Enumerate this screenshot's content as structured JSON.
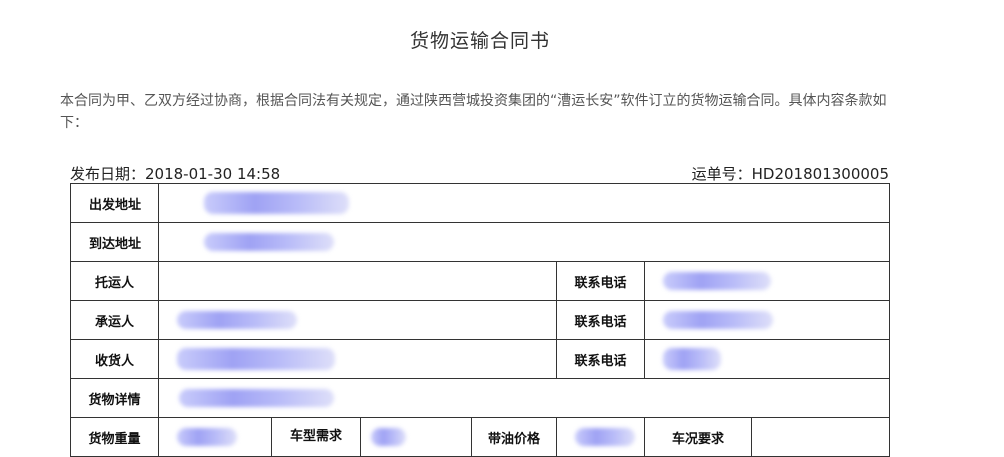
{
  "document": {
    "title": "货物运输合同书",
    "intro": "本合同为甲、乙双方经过协商，根据合同法有关规定，通过陕西营城投资集团的“漕运长安”软件订立的货物运输合同。具体内容条款如下：",
    "publish_date": "发布日期：2018-01-30 14:58",
    "waybill_no": "运单号：HD201801300005"
  },
  "table": {
    "departure_label": "出发地址",
    "destination_label": "到达地址",
    "consignor_label": "托运人",
    "consignor_phone_label": "联系电话",
    "carrier_label": "承运人",
    "carrier_phone_label": "联系电话",
    "consignee_label": "收货人",
    "consignee_phone_label": "联系电话",
    "cargo_details_label": "货物详情",
    "cargo_weight_label": "货物重量",
    "vehicle_type_label": "车型需求",
    "price_with_fuel_label": "带油价格",
    "vehicle_condition_label": "车况要求"
  }
}
